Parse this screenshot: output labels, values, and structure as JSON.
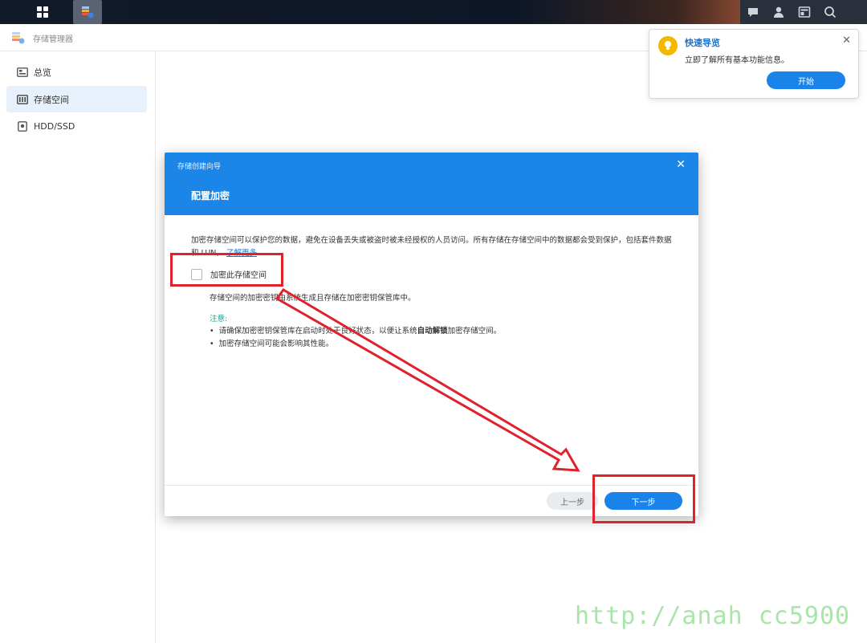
{
  "app": {
    "title": "存储管理器"
  },
  "sidebar": {
    "items": [
      {
        "label": "总览",
        "icon": "overview-icon"
      },
      {
        "label": "存储空间",
        "icon": "storage-icon",
        "active": true
      },
      {
        "label": "HDD/SSD",
        "icon": "disk-icon"
      }
    ]
  },
  "toast": {
    "title": "快速导览",
    "description": "立即了解所有基本功能信息。",
    "button": "开始",
    "close": "✕"
  },
  "dialog": {
    "window_title": "存储创建向导",
    "close": "✕",
    "step_title": "配置加密",
    "description": "加密存储空间可以保护您的数据，避免在设备丢失或被盗时被未经授权的人员访问。所有存储在存储空间中的数据都会受到保护，包括套件数据和 LUN。",
    "learn_more": "了解更多",
    "checkbox_label": "加密此存储空间",
    "checkbox_checked": false,
    "sub_text": "存储空间的加密密钥由系统生成且存储在加密密钥保管库中。",
    "note_title": "注意:",
    "note_1_prefix": "请确保加密密钥保管库在启动时处于良好状态，以便让系统",
    "note_1_bold": "自动解锁",
    "note_1_suffix": "加密存储空间。",
    "note_2": "加密存储空间可能会影响其性能。",
    "prev_button": "上一步",
    "next_button": "下一步"
  },
  "watermark": "http://anah cc5900",
  "colors": {
    "accent": "#1a83ea",
    "dialog_header": "#1b85e8",
    "annotation_red": "#e0222c",
    "note_green": "#1ba391"
  }
}
